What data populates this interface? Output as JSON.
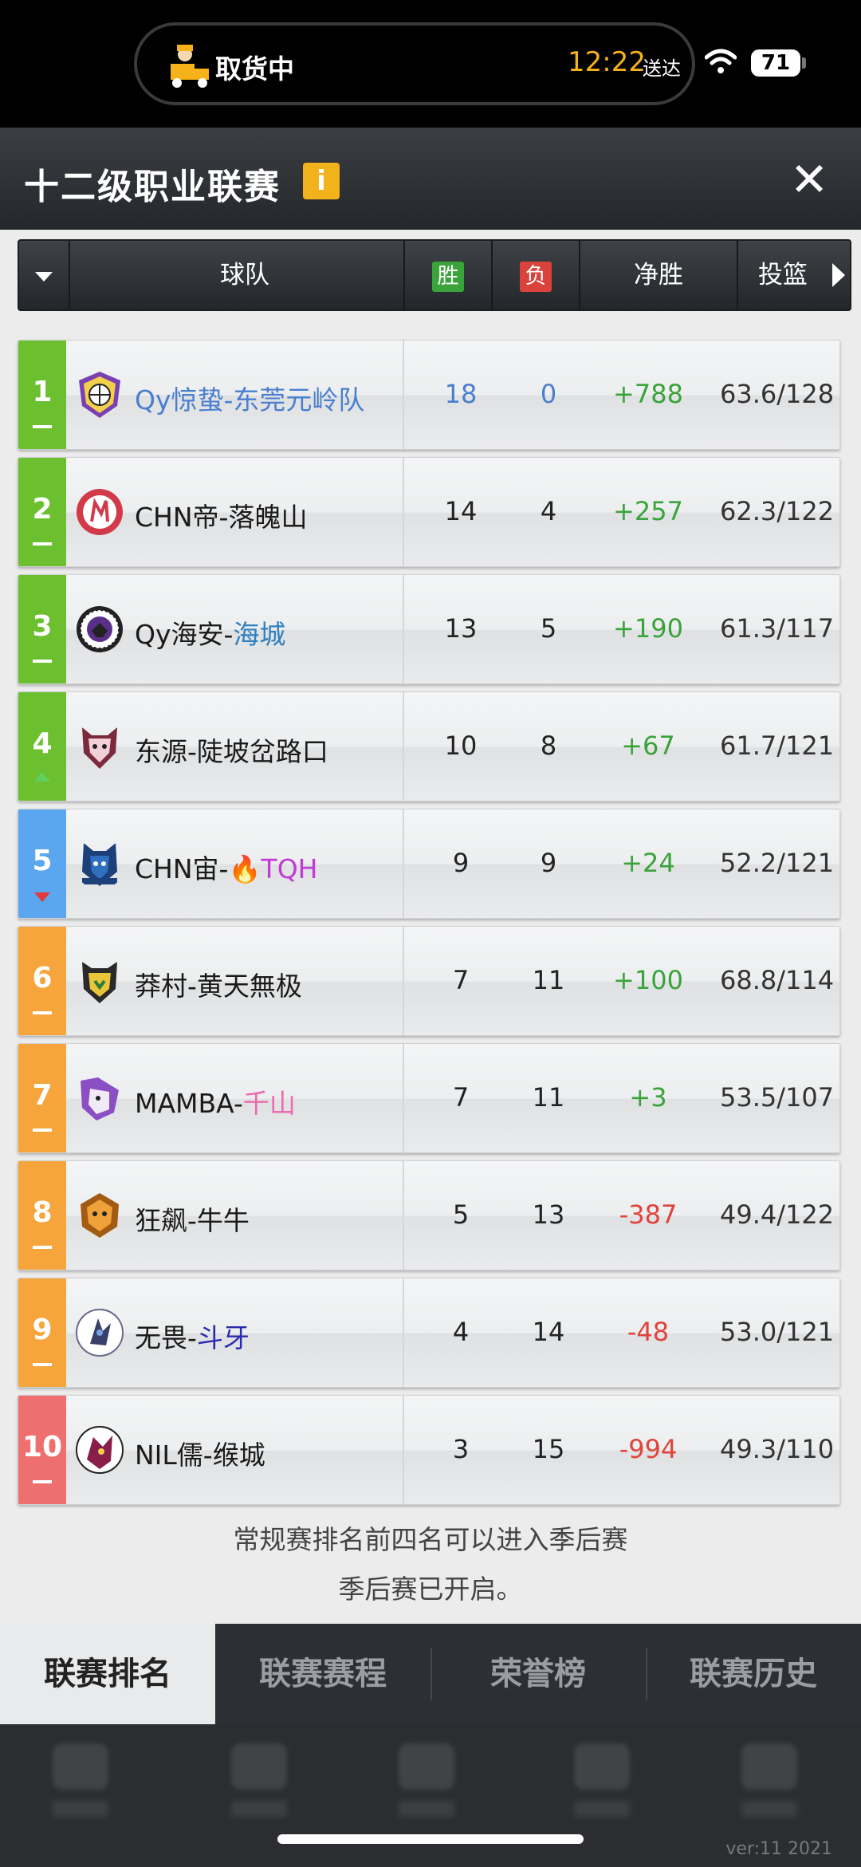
{
  "status_bar": {
    "delivery_text": "取货中",
    "eta_time": "12:22",
    "eta_suffix": "送达",
    "battery": "71"
  },
  "header": {
    "title": "十二级职业联赛",
    "info_label": "i",
    "close_label": "✕"
  },
  "columns": {
    "team": "球队",
    "wins": "胜",
    "losses": "负",
    "net": "净胜",
    "shooting": "投篮"
  },
  "colors": {
    "green": "#6cbf2e",
    "blue": "#5aa7ef",
    "orange": "#f6a53c",
    "red": "#ee6f6f",
    "positive": "#3aa33a",
    "negative": "#e0443b"
  },
  "standings": [
    {
      "rank": "1",
      "team": "Qy惊蛰-东莞元岭队",
      "wins": "18",
      "losses": "0",
      "net": "+788",
      "shooting": "63.6/128",
      "trend": "same"
    },
    {
      "rank": "2",
      "team": "CHN帝-落魄山",
      "wins": "14",
      "losses": "4",
      "net": "+257",
      "shooting": "62.3/122",
      "trend": "same"
    },
    {
      "rank": "3",
      "team_prefix": "Qy海安-",
      "team_suffix": "海城",
      "wins": "13",
      "losses": "5",
      "net": "+190",
      "shooting": "61.3/117",
      "trend": "same"
    },
    {
      "rank": "4",
      "team": "东源-陡坡岔路口",
      "wins": "10",
      "losses": "8",
      "net": "+67",
      "shooting": "61.7/121",
      "trend": "up"
    },
    {
      "rank": "5",
      "team_prefix": "CHN宙-",
      "team_emoji": "🔥",
      "team_suffix": "TQH",
      "wins": "9",
      "losses": "9",
      "net": "+24",
      "shooting": "52.2/121",
      "trend": "down"
    },
    {
      "rank": "6",
      "team": "莽村-黄天無极",
      "wins": "7",
      "losses": "11",
      "net": "+100",
      "shooting": "68.8/114",
      "trend": "same"
    },
    {
      "rank": "7",
      "team_prefix": "MAMBA-",
      "team_suffix": "千山",
      "wins": "7",
      "losses": "11",
      "net": "+3",
      "shooting": "53.5/107",
      "trend": "same"
    },
    {
      "rank": "8",
      "team": "狂飙-牛牛",
      "wins": "5",
      "losses": "13",
      "net": "-387",
      "shooting": "49.4/122",
      "trend": "same"
    },
    {
      "rank": "9",
      "team_prefix": "无畏-",
      "team_suffix": "斗牙",
      "wins": "4",
      "losses": "14",
      "net": "-48",
      "shooting": "53.0/121",
      "trend": "same"
    },
    {
      "rank": "10",
      "team": "NIL儒-缑城",
      "wins": "3",
      "losses": "15",
      "net": "-994",
      "shooting": "49.3/110",
      "trend": "same"
    }
  ],
  "notice": {
    "line1": "常规赛排名前四名可以进入季后赛",
    "line2": "季后赛已开启。"
  },
  "tabs": {
    "ranking": "联赛排名",
    "schedule": "联赛赛程",
    "honor": "荣誉榜",
    "history": "联赛历史"
  },
  "footer": {
    "version": "ver:11  2021"
  }
}
